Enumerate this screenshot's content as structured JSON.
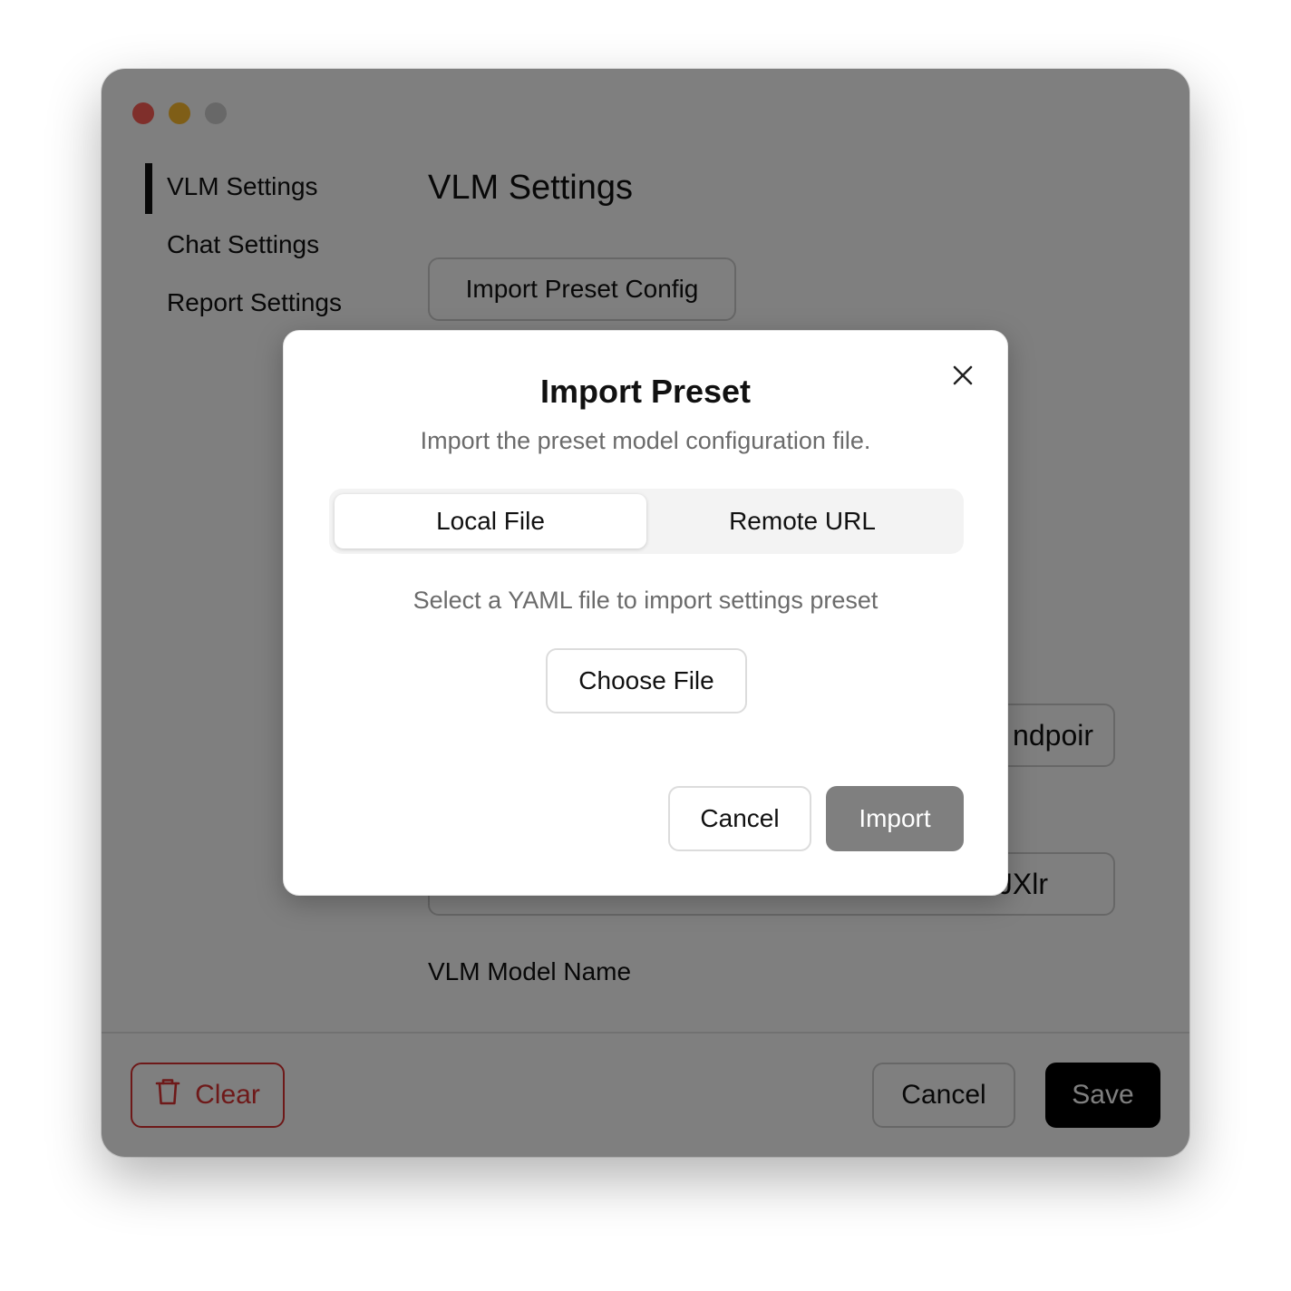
{
  "sidebar": {
    "items": [
      {
        "label": "VLM Settings",
        "active": true
      },
      {
        "label": "Chat Settings",
        "active": false
      },
      {
        "label": "Report Settings",
        "active": false
      }
    ]
  },
  "main": {
    "title": "VLM Settings",
    "import_preset_button": "Import Preset Config",
    "endpoint_field_visible_text": "ndpoir",
    "api_key_field_visible_text": "JXlr",
    "model_name_label": "VLM Model Name"
  },
  "footer": {
    "clear_label": "Clear",
    "cancel_label": "Cancel",
    "save_label": "Save"
  },
  "modal": {
    "title": "Import Preset",
    "subtitle": "Import the preset model configuration file.",
    "tabs": [
      {
        "label": "Local File",
        "active": true
      },
      {
        "label": "Remote URL",
        "active": false
      }
    ],
    "hint": "Select a YAML file to import settings preset",
    "choose_file_label": "Choose File",
    "cancel_label": "Cancel",
    "import_label": "Import"
  },
  "colors": {
    "close_red": "#ff5f57",
    "minimize_yellow": "#febc2e",
    "zoom_gray": "#d0d0d0",
    "danger": "#dd3333",
    "primary_dark": "#000000",
    "disabled_import": "#7f7f7f"
  },
  "icons": [
    "close-icon",
    "trash-icon"
  ]
}
